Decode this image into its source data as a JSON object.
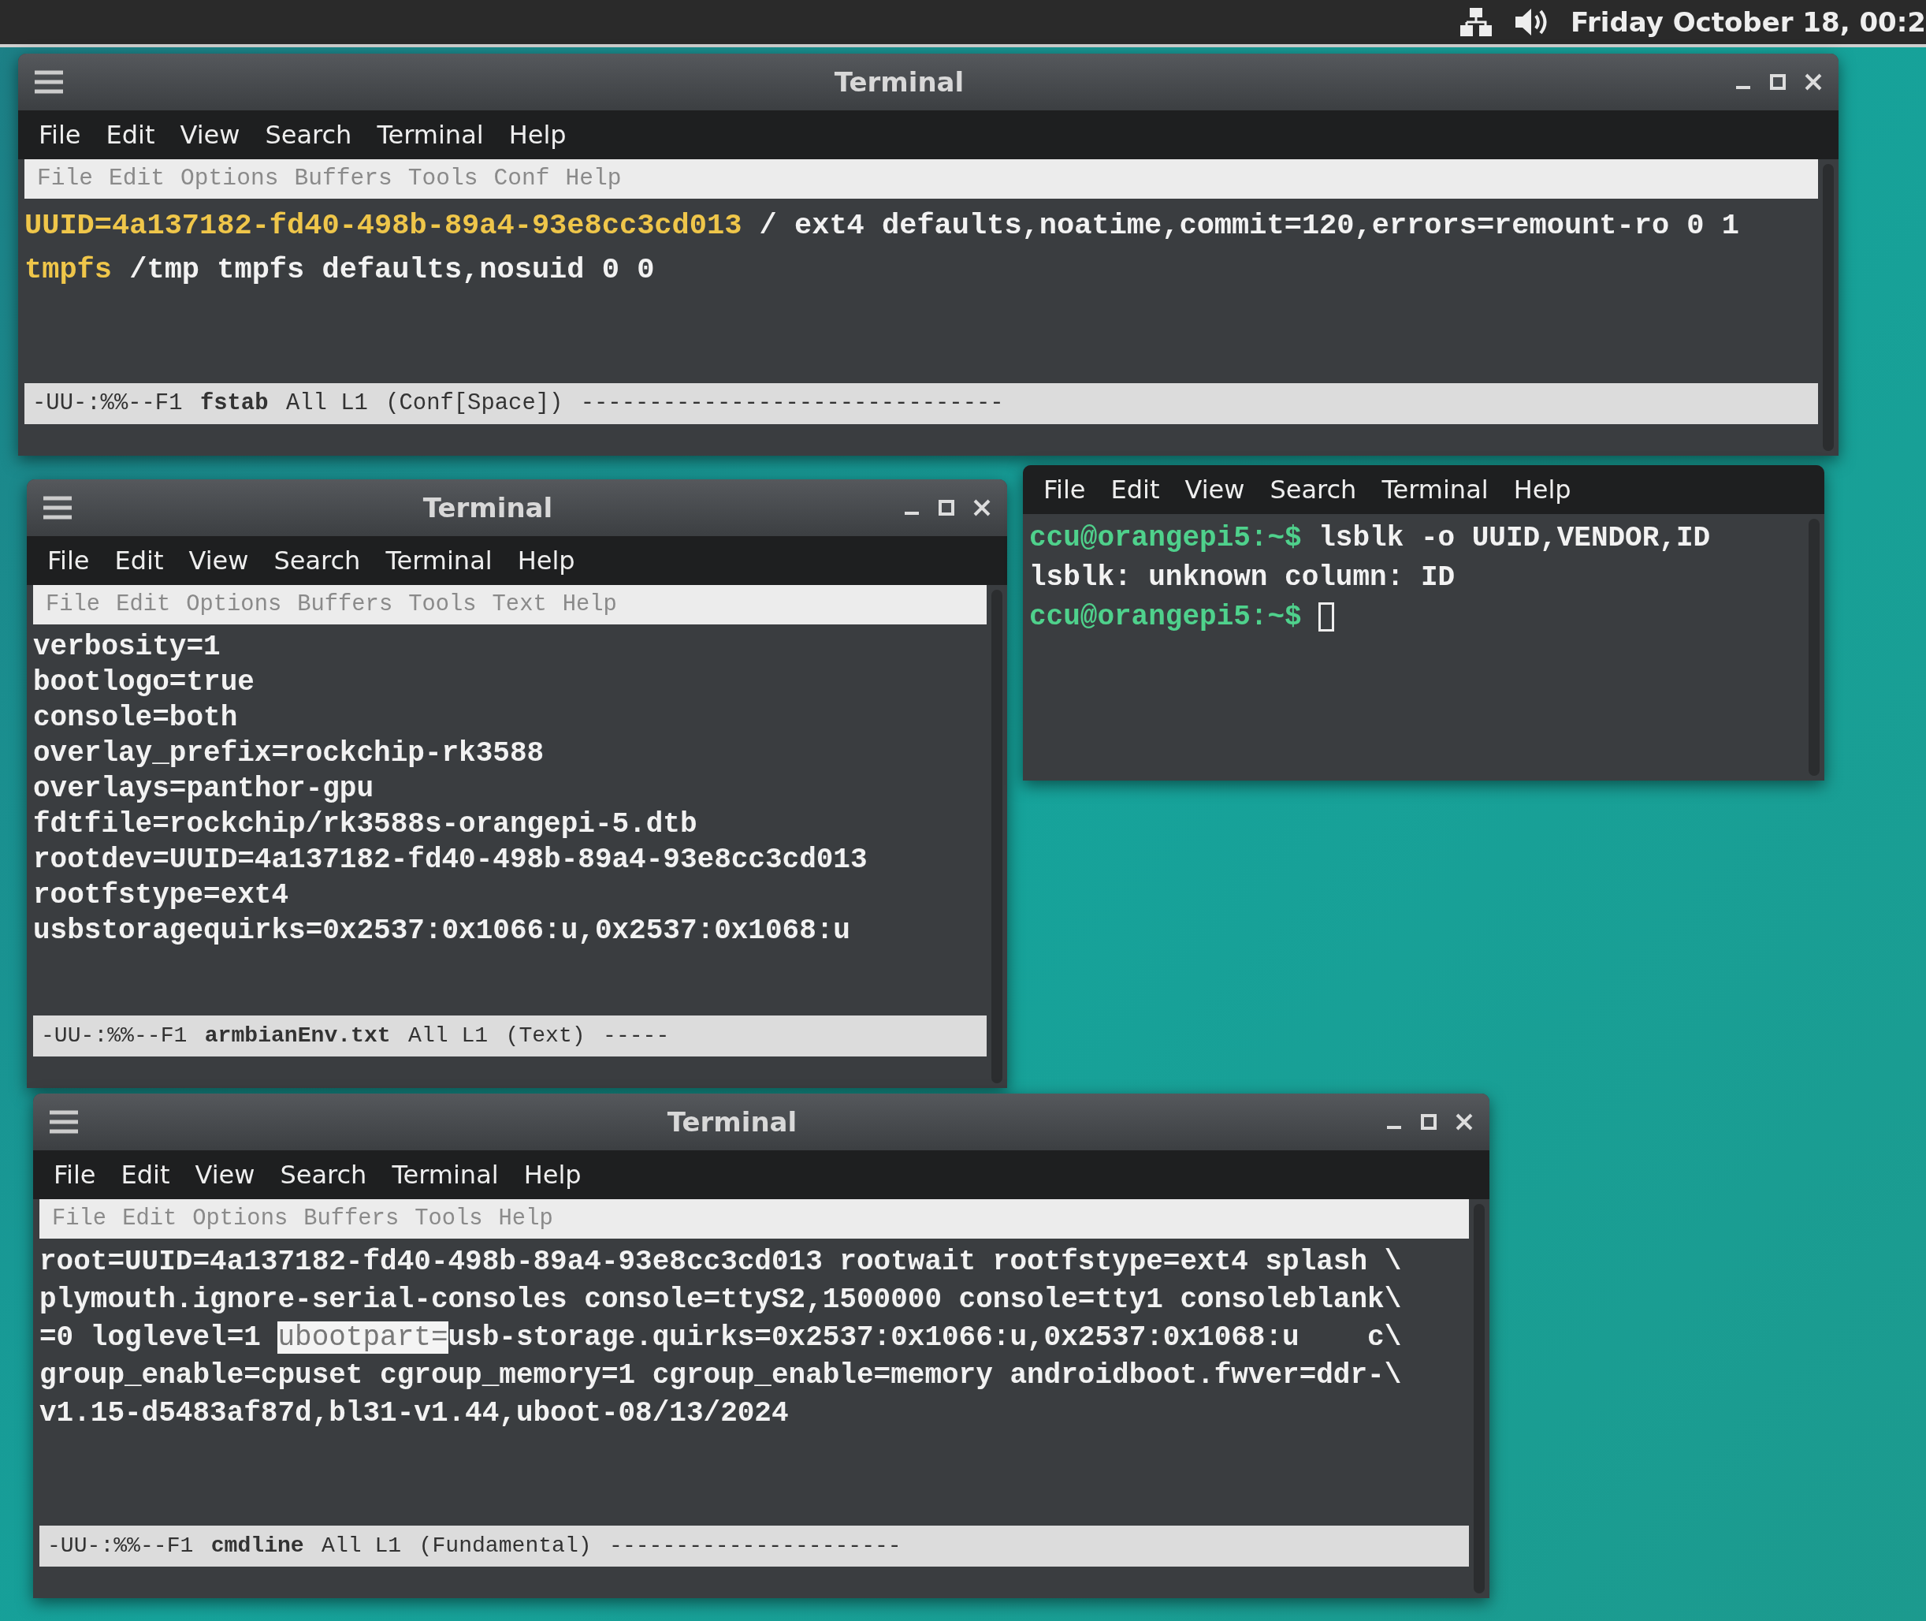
{
  "top_bar": {
    "status_text": "Friday October 18, 00:2"
  },
  "windows": [
    {
      "title": "Terminal",
      "kind": "emacs",
      "menu": [
        "File",
        "Edit",
        "View",
        "Search",
        "Terminal",
        "Help"
      ],
      "emacs_menu": [
        "File",
        "Edit",
        "Options",
        "Buffers",
        "Tools",
        "Conf",
        "Help"
      ],
      "lines": [
        [
          {
            "text": "UUID=4a137182-fd40-498b-89a4-93e8cc3cd013",
            "kind": "keyword"
          },
          {
            "text": " / ext4 defaults,noatime,commit=120,errors=remount-ro 0 1",
            "kind": "plain"
          }
        ],
        [
          {
            "text": "tmpfs",
            "kind": "keyword"
          },
          {
            "text": " /tmp tmpfs defaults,nosuid 0 0",
            "kind": "plain"
          }
        ]
      ],
      "mode_line": {
        "status": "-UU-:%%--F1",
        "buffer": "fstab",
        "position": "All L1",
        "mode": "(Conf[Space])",
        "fill": "-------------------------------"
      }
    },
    {
      "title": "Terminal",
      "kind": "emacs",
      "menu": [
        "File",
        "Edit",
        "View",
        "Search",
        "Terminal",
        "Help"
      ],
      "emacs_menu": [
        "File",
        "Edit",
        "Options",
        "Buffers",
        "Tools",
        "Text",
        "Help"
      ],
      "lines": [
        [
          {
            "text": "verbosity=1",
            "kind": "plain"
          }
        ],
        [
          {
            "text": "bootlogo=true",
            "kind": "plain"
          }
        ],
        [
          {
            "text": "console=both",
            "kind": "plain"
          }
        ],
        [
          {
            "text": "overlay_prefix=rockchip-rk3588",
            "kind": "plain"
          }
        ],
        [
          {
            "text": "overlays=panthor-gpu",
            "kind": "plain"
          }
        ],
        [
          {
            "text": "fdtfile=rockchip/rk3588s-orangepi-5.dtb",
            "kind": "plain"
          }
        ],
        [
          {
            "text": "rootdev=UUID=4a137182-fd40-498b-89a4-93e8cc3cd013",
            "kind": "plain"
          }
        ],
        [
          {
            "text": "rootfstype=ext4",
            "kind": "plain"
          }
        ],
        [
          {
            "text": "usbstoragequirks=0x2537:0x1066:u,0x2537:0x1068:u",
            "kind": "plain"
          }
        ]
      ],
      "mode_line": {
        "status": "-UU-:%%--F1",
        "buffer": "armbianEnv.txt",
        "position": "All L1",
        "mode": "(Text)",
        "fill": "-----"
      }
    },
    {
      "kind": "shell",
      "menu": [
        "File",
        "Edit",
        "View",
        "Search",
        "Terminal",
        "Help"
      ],
      "lines": [
        [
          {
            "text": "ccu@orangepi5:~$",
            "kind": "prompt"
          },
          {
            "text": " lsblk -o UUID,VENDOR,ID",
            "kind": "plain"
          }
        ],
        [
          {
            "text": "lsblk: unknown column: ID",
            "kind": "plain"
          }
        ],
        [
          {
            "text": "ccu@orangepi5:~$",
            "kind": "prompt"
          },
          {
            "kind": "cursor"
          }
        ]
      ]
    },
    {
      "title": "Terminal",
      "kind": "emacs",
      "menu": [
        "File",
        "Edit",
        "View",
        "Search",
        "Terminal",
        "Help"
      ],
      "emacs_menu": [
        "File",
        "Edit",
        "Options",
        "Buffers",
        "Tools",
        "Help"
      ],
      "lines": [
        [
          {
            "text": "root=UUID=4a137182-fd40-498b-89a4-93e8cc3cd013 rootwait rootfstype=ext4 splash \\",
            "kind": "plain"
          }
        ],
        [
          {
            "text": "plymouth.ignore-serial-consoles console=ttyS2,1500000 console=tty1 consoleblank\\",
            "kind": "plain"
          }
        ],
        [
          {
            "text": "=0 loglevel=1 ",
            "kind": "plain"
          },
          {
            "text": "ubootpart=",
            "kind": "region"
          },
          {
            "text": "usb-storage.quirks=0x2537:0x1066:u,0x2537:0x1068:u    c\\",
            "kind": "plain"
          }
        ],
        [
          {
            "text": "group_enable=cpuset cgroup_memory=1 cgroup_enable=memory androidboot.fwver=ddr-\\",
            "kind": "plain"
          }
        ],
        [
          {
            "text": "v1.15-d5483af87d,bl31-v1.44,uboot-08/13/2024",
            "kind": "plain"
          }
        ]
      ],
      "mode_line": {
        "status": "-UU-:%%--F1",
        "buffer": "cmdline",
        "position": "All L1",
        "mode": "(Fundamental)",
        "fill": "----------------------"
      }
    }
  ]
}
